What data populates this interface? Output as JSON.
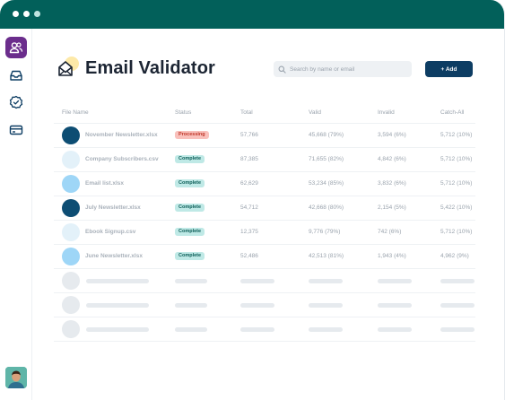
{
  "app": {
    "title": "Email Validator"
  },
  "sidebar": {
    "items": [
      {
        "icon": "users-icon",
        "active": true
      },
      {
        "icon": "inbox-icon",
        "active": false
      },
      {
        "icon": "check-badge-icon",
        "active": false
      },
      {
        "icon": "credit-card-icon",
        "active": false
      }
    ]
  },
  "header": {
    "title": "Email Validator",
    "search_placeholder": "Search by name or email",
    "add_label": "+ Add"
  },
  "table": {
    "columns": [
      "File Name",
      "Status",
      "Total",
      "Valid",
      "Invalid",
      "Catch-All"
    ],
    "rows": [
      {
        "file": "November Newsletter.xlsx",
        "status": "Processing",
        "total": "57,766",
        "valid": "45,668 (79%)",
        "invalid": "3,594 (6%)",
        "catch_all": "5,712 (10%)",
        "icon_color": "#0d4d73"
      },
      {
        "file": "Company Subscribers.csv",
        "status": "Complete",
        "total": "87,385",
        "valid": "71,655 (82%)",
        "invalid": "4,842 (6%)",
        "catch_all": "5,712 (10%)",
        "icon_color": "#e3f1f9"
      },
      {
        "file": "Email list.xlsx",
        "status": "Complete",
        "total": "62,629",
        "valid": "53,234 (85%)",
        "invalid": "3,832 (6%)",
        "catch_all": "5,712 (10%)",
        "icon_color": "#9ed6f7"
      },
      {
        "file": "July Newsletter.xlsx",
        "status": "Complete",
        "total": "54,712",
        "valid": "42,668 (80%)",
        "invalid": "2,154 (5%)",
        "catch_all": "5,422 (10%)",
        "icon_color": "#0d4d73"
      },
      {
        "file": "Ebook Signup.csv",
        "status": "Complete",
        "total": "12,375",
        "valid": "9,776 (79%)",
        "invalid": "742 (6%)",
        "catch_all": "5,712 (10%)",
        "icon_color": "#e3f1f9"
      },
      {
        "file": "June Newsletter.xlsx",
        "status": "Complete",
        "total": "52,486",
        "valid": "42,513 (81%)",
        "invalid": "1,943 (4%)",
        "catch_all": "4,962 (9%)",
        "icon_color": "#9ed6f7"
      }
    ],
    "placeholder_rows": 3
  },
  "colors": {
    "titlebar": "#02605a",
    "sidebar_active": "#6b2d8c",
    "primary_button": "#0d3d63",
    "processing_badge": "#f9c0bb",
    "complete_badge": "#bfe9e6"
  }
}
